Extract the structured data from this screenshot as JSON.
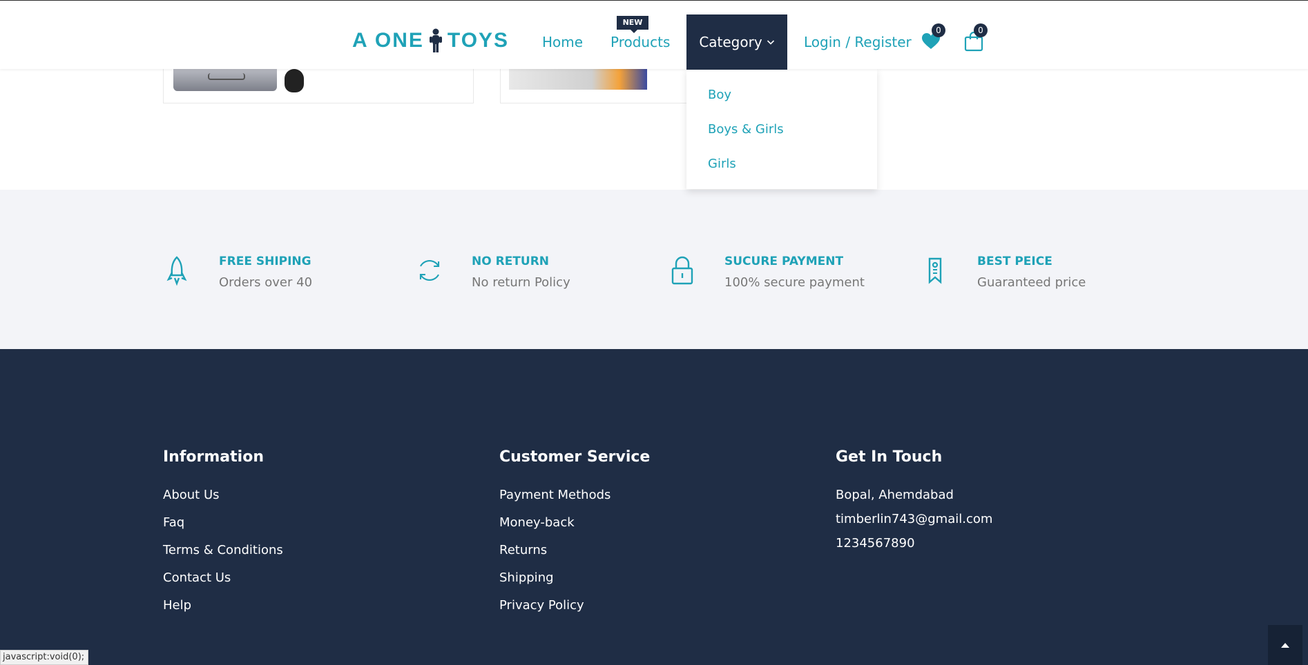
{
  "header": {
    "logo_text_left": "A ONE",
    "logo_text_right": "TOYS",
    "nav": {
      "home": "Home",
      "products": "Products",
      "products_badge": "NEW",
      "category": "Category",
      "login": "Login / Register"
    },
    "wishlist_count": "0",
    "cart_count": "0"
  },
  "category_dropdown": {
    "items": [
      "Boy",
      "Boys & Girls",
      "Girls"
    ]
  },
  "features": [
    {
      "icon": "rocket-icon",
      "title": "FREE SHIPING",
      "subtitle": "Orders over 40"
    },
    {
      "icon": "refresh-icon",
      "title": "NO RETURN",
      "subtitle": "No return Policy"
    },
    {
      "icon": "lock-icon",
      "title": "SUCURE PAYMENT",
      "subtitle": "100% secure payment"
    },
    {
      "icon": "tag-icon",
      "title": "BEST PEICE",
      "subtitle": "Guaranteed price"
    }
  ],
  "footer": {
    "information": {
      "title": "Information",
      "links": [
        "About Us",
        "Faq",
        "Terms & Conditions",
        "Contact Us",
        "Help"
      ]
    },
    "customer_service": {
      "title": "Customer Service",
      "links": [
        "Payment Methods",
        "Money-back",
        "Returns",
        "Shipping",
        "Privacy Policy"
      ]
    },
    "get_in_touch": {
      "title": "Get In Touch",
      "address": "Bopal, Ahemdabad",
      "email": "timberlin743@gmail.com",
      "phone": "1234567890"
    }
  },
  "status_bar": "javascript:void(0);",
  "colors": {
    "accent": "#1fa2b7",
    "dark": "#1f2d45",
    "band": "#f3f4f8",
    "muted": "#777777"
  }
}
